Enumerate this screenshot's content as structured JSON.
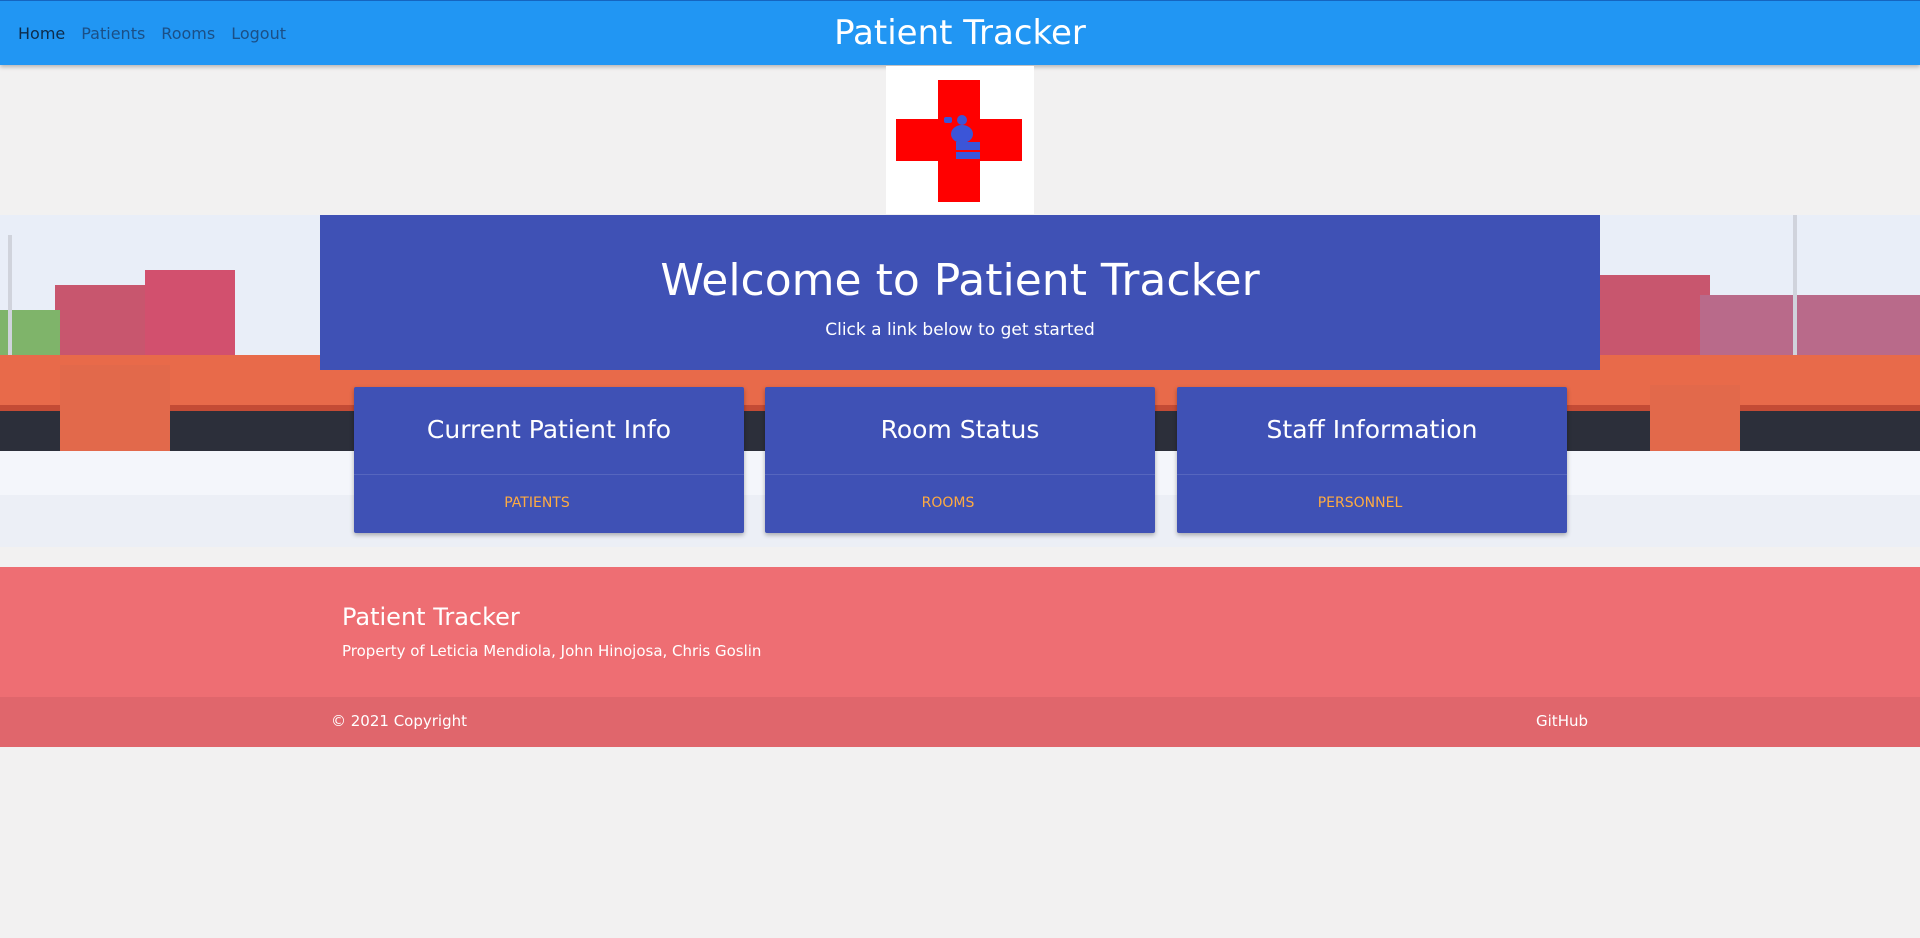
{
  "nav": {
    "links": [
      "Home",
      "Patients",
      "Rooms",
      "Logout"
    ],
    "brand": "Patient Tracker"
  },
  "hero": {
    "title": "Welcome to Patient Tracker",
    "subtitle": "Click a link below to get started"
  },
  "cards": [
    {
      "title": "Current Patient Info",
      "action": "PATIENTS"
    },
    {
      "title": "Room Status",
      "action": "ROOMS"
    },
    {
      "title": "Staff Information",
      "action": "PERSONNEL"
    }
  ],
  "footer": {
    "title": "Patient Tracker",
    "text": "Property of Leticia Mendiola, John Hinojosa, Chris Goslin",
    "copyright": "© 2021 Copyright",
    "github": "GitHub"
  },
  "colors": {
    "navbar": "#2196f3",
    "panel": "#3f51b5",
    "action": "#ffab40",
    "footer": "#ee6e73",
    "cross": "#ff0000"
  },
  "icons": {
    "logo": "red-cross-logo-icon"
  }
}
